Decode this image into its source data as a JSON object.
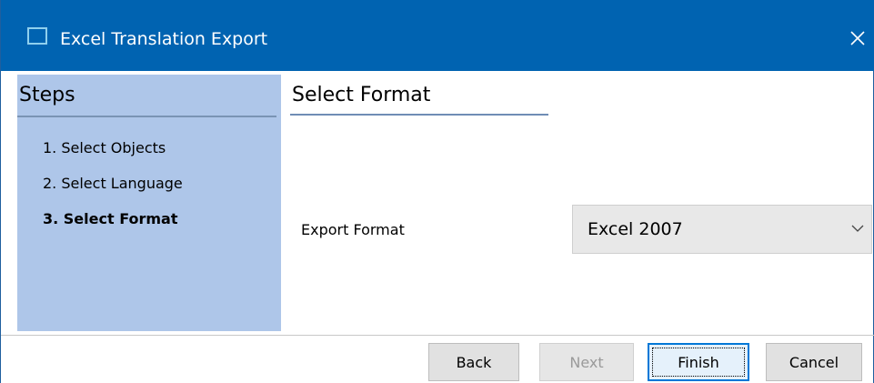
{
  "window": {
    "title": "Excel Translation Export",
    "close_glyph": "✕"
  },
  "steps": {
    "heading": "Steps",
    "items": [
      {
        "label": "1. Select Objects",
        "active": false
      },
      {
        "label": "2. Select Language",
        "active": false
      },
      {
        "label": "3. Select Format",
        "active": true
      }
    ]
  },
  "main": {
    "section_title": "Select Format",
    "field_label": "Export Format",
    "format_select": {
      "value": "Excel 2007"
    }
  },
  "buttons": {
    "back": "Back",
    "next": "Next",
    "finish": "Finish",
    "cancel": "Cancel"
  },
  "colors": {
    "titlebar": "#0063b1",
    "steps_panel": "#aec6e9",
    "accent": "#0078d7"
  }
}
